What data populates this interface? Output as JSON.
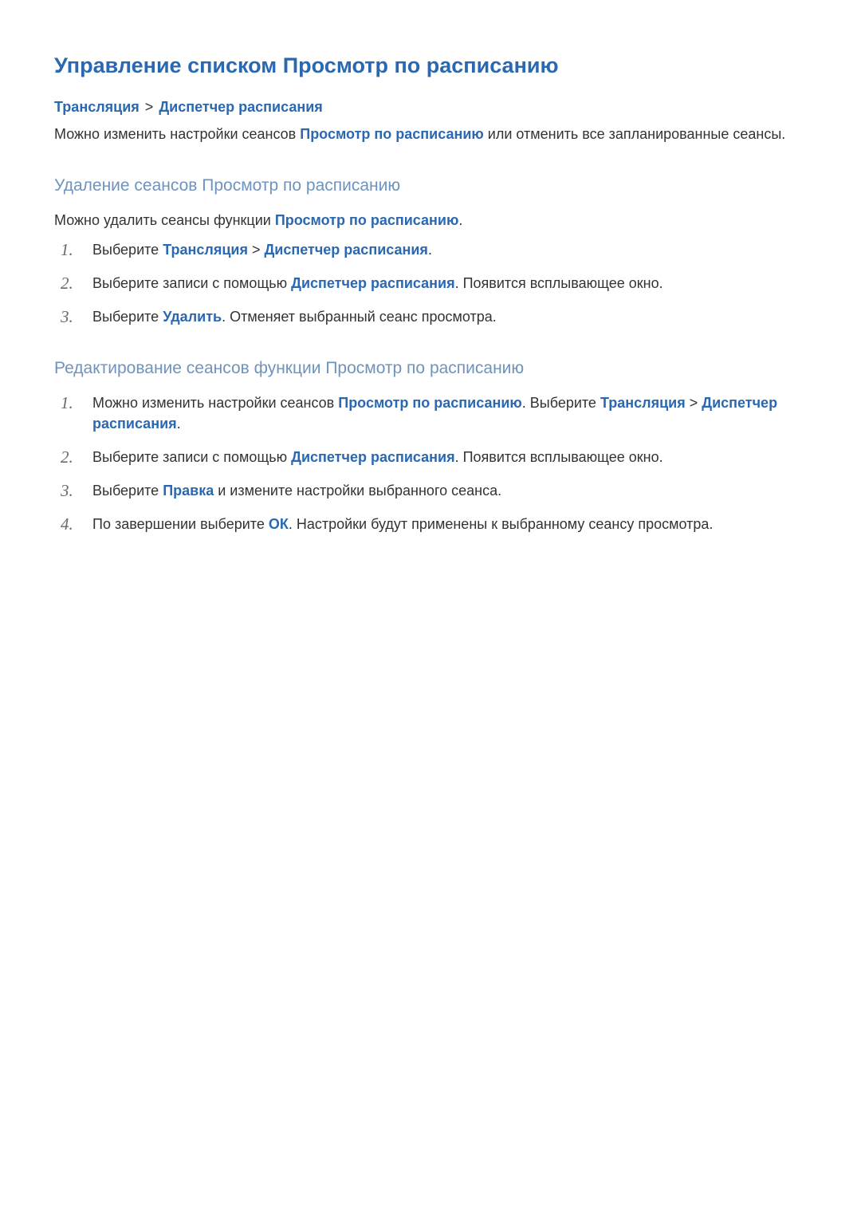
{
  "title": "Управление списком Просмотр по расписанию",
  "breadcrumb": {
    "part1": "Трансляция",
    "sep": ">",
    "part2": "Диспетчер расписания"
  },
  "intro": {
    "pre": "Можно изменить настройки сеансов ",
    "kw": "Просмотр по расписанию",
    "post": " или отменить все запланированные сеансы."
  },
  "section1": {
    "heading": "Удаление сеансов Просмотр по расписанию",
    "lead": {
      "pre": "Можно удалить сеансы функции ",
      "kw": "Просмотр по расписанию",
      "post": "."
    },
    "steps": [
      {
        "parts": [
          {
            "t": "Выберите "
          },
          {
            "t": "Трансляция",
            "kw": true
          },
          {
            "t": " > "
          },
          {
            "t": "Диспетчер расписания",
            "kw": true
          },
          {
            "t": "."
          }
        ]
      },
      {
        "parts": [
          {
            "t": "Выберите записи с помощью "
          },
          {
            "t": "Диспетчер расписания",
            "kw": true
          },
          {
            "t": ". Появится всплывающее окно."
          }
        ]
      },
      {
        "parts": [
          {
            "t": "Выберите "
          },
          {
            "t": "Удалить",
            "kw": true
          },
          {
            "t": ". Отменяет выбранный сеанс просмотра."
          }
        ]
      }
    ]
  },
  "section2": {
    "heading": "Редактирование сеансов функции Просмотр по расписанию",
    "steps": [
      {
        "parts": [
          {
            "t": "Можно изменить настройки сеансов "
          },
          {
            "t": "Просмотр по расписанию",
            "kw": true
          },
          {
            "t": ". Выберите "
          },
          {
            "t": "Трансляция",
            "kw": true
          },
          {
            "t": " > "
          },
          {
            "t": "Диспетчер расписания",
            "kw": true
          },
          {
            "t": "."
          }
        ]
      },
      {
        "parts": [
          {
            "t": "Выберите записи с помощью "
          },
          {
            "t": "Диспетчер расписания",
            "kw": true
          },
          {
            "t": ". Появится всплывающее окно."
          }
        ]
      },
      {
        "parts": [
          {
            "t": "Выберите "
          },
          {
            "t": "Правка",
            "kw": true
          },
          {
            "t": " и измените настройки выбранного сеанса."
          }
        ]
      },
      {
        "parts": [
          {
            "t": "По завершении выберите "
          },
          {
            "t": "ОК",
            "kw": true
          },
          {
            "t": ". Настройки будут применены к выбранному сеансу просмотра."
          }
        ]
      }
    ]
  }
}
